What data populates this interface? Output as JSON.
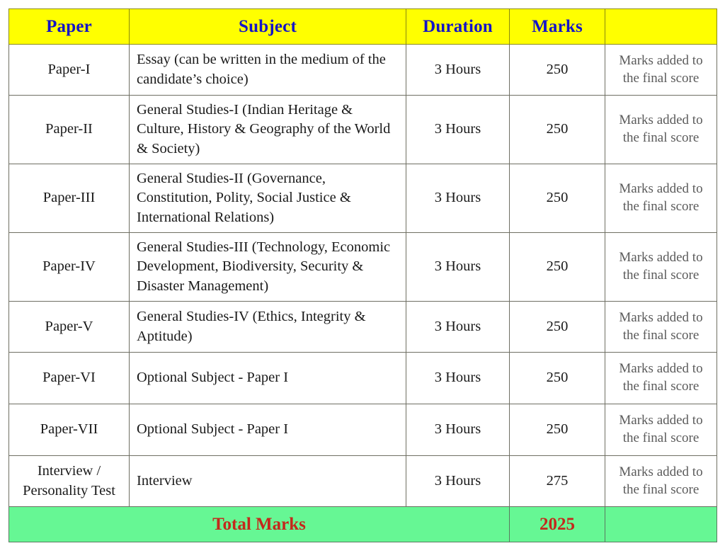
{
  "table": {
    "columns": [
      {
        "key": "paper",
        "label": "Paper"
      },
      {
        "key": "subject",
        "label": "Subject"
      },
      {
        "key": "duration",
        "label": "Duration"
      },
      {
        "key": "marks",
        "label": "Marks"
      },
      {
        "key": "remark",
        "label": ""
      }
    ],
    "rows": [
      {
        "paper": "Paper-I",
        "subject": "Essay (can be written in the medium of the candidate’s choice)",
        "duration": "3 Hours",
        "marks": "250",
        "remark": "Marks added to the final score"
      },
      {
        "paper": "Paper-II",
        "subject": "General Studies-I (Indian Heritage & Culture, History & Geography of the World & Society)",
        "duration": "3 Hours",
        "marks": "250",
        "remark": "Marks added to the final score"
      },
      {
        "paper": "Paper-III",
        "subject": "General Studies-II (Governance, Constitution, Polity, Social Justice & International Relations)",
        "duration": "3 Hours",
        "marks": "250",
        "remark": "Marks added to the final score"
      },
      {
        "paper": "Paper-IV",
        "subject": "General Studies-III (Technology, Economic Development, Biodiversity, Security & Disaster Management)",
        "duration": "3 Hours",
        "marks": "250",
        "remark": "Marks added to the final score"
      },
      {
        "paper": "Paper-V",
        "subject": "General Studies-IV (Ethics, Integrity & Aptitude)",
        "duration": "3 Hours",
        "marks": "250",
        "remark": "Marks added to the final score"
      },
      {
        "paper": "Paper-VI",
        "subject": "Optional Subject - Paper I",
        "duration": "3 Hours",
        "marks": "250",
        "remark": "Marks added to the final score"
      },
      {
        "paper": "Paper-VII",
        "subject": "Optional Subject - Paper I",
        "duration": "3 Hours",
        "marks": "250",
        "remark": "Marks added to the final score"
      },
      {
        "paper": "Interview / Personality Test",
        "subject": "Interview",
        "duration": "3 Hours",
        "marks": "275",
        "remark": "Marks added to the final score"
      }
    ],
    "total": {
      "label": "Total Marks",
      "value": "2025",
      "trailing": ""
    }
  },
  "colors": {
    "header_background": "#FFFF00",
    "header_text": "#1414C8",
    "total_background": "#66F794",
    "total_text": "#C4281C",
    "border": "#6F6F63",
    "remark_text": "#5B5B5B"
  }
}
